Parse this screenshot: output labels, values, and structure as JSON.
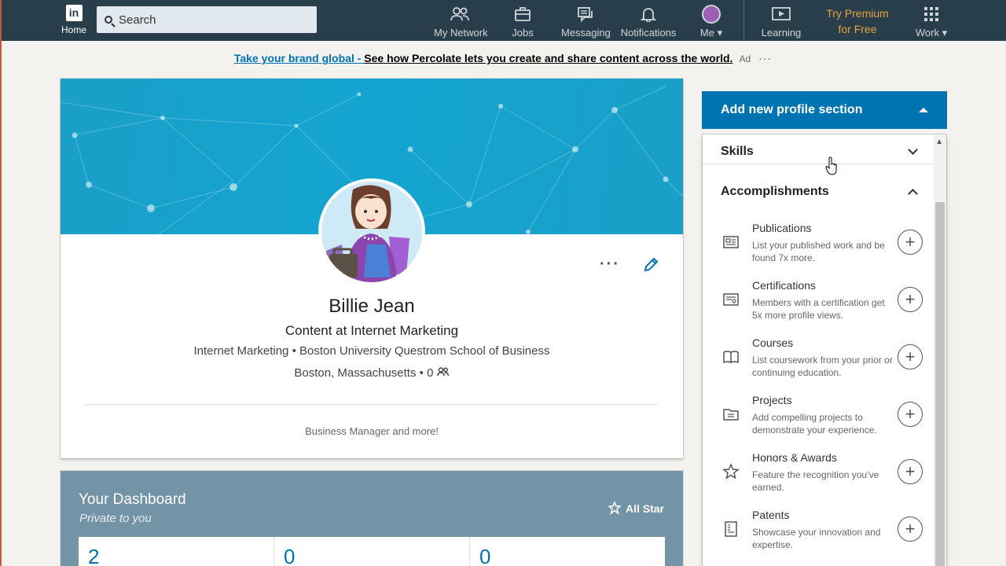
{
  "nav": {
    "home_label": "Home",
    "logo_text": "in",
    "search_placeholder": "Search",
    "items": [
      {
        "label": "My Network",
        "icon": "network-icon"
      },
      {
        "label": "Jobs",
        "icon": "briefcase-icon"
      },
      {
        "label": "Messaging",
        "icon": "messaging-icon"
      },
      {
        "label": "Notifications",
        "icon": "bell-icon"
      },
      {
        "label": "Me",
        "icon": "avatar"
      },
      {
        "label": "Learning",
        "icon": "learning-icon"
      },
      {
        "label": "Work",
        "icon": "grid-icon"
      }
    ],
    "premium_line1": "Try Premium",
    "premium_line2": "for Free"
  },
  "ad": {
    "part1": "Take your brand global - ",
    "part2": "See how Percolate lets you create and share content across the world.",
    "tag": "Ad",
    "more": "···"
  },
  "profile": {
    "name": "Billie Jean",
    "headline": "Content at Internet Marketing",
    "company": "Internet Marketing",
    "school": "Boston University Questrom School of Business",
    "location": "Boston, Massachusetts",
    "connections": "0",
    "separator": "•",
    "footer": "Business Manager and more!"
  },
  "dashboard": {
    "title": "Your Dashboard",
    "subtitle": "Private to you",
    "badge": "All Star",
    "stats": [
      "2",
      "0",
      "0"
    ]
  },
  "panel": {
    "add_section_label": "Add new profile section",
    "skills_label": "Skills",
    "accomplishments_label": "Accomplishments",
    "items": [
      {
        "title": "Publications",
        "desc": "List your published work and be found 7x more."
      },
      {
        "title": "Certifications",
        "desc": "Members with a certification get 5x more profile views."
      },
      {
        "title": "Courses",
        "desc": "List coursework from your prior or continuing education."
      },
      {
        "title": "Projects",
        "desc": "Add compelling projects to demonstrate your experience."
      },
      {
        "title": "Honors & Awards",
        "desc": "Feature the recognition you’ve earned."
      },
      {
        "title": "Patents",
        "desc": "Showcase your innovation and expertise."
      }
    ]
  },
  "colors": {
    "nav_bg": "#283e4a",
    "accent": "#0073b1",
    "premium": "#e7a33e",
    "banner": "#13a5d0"
  }
}
